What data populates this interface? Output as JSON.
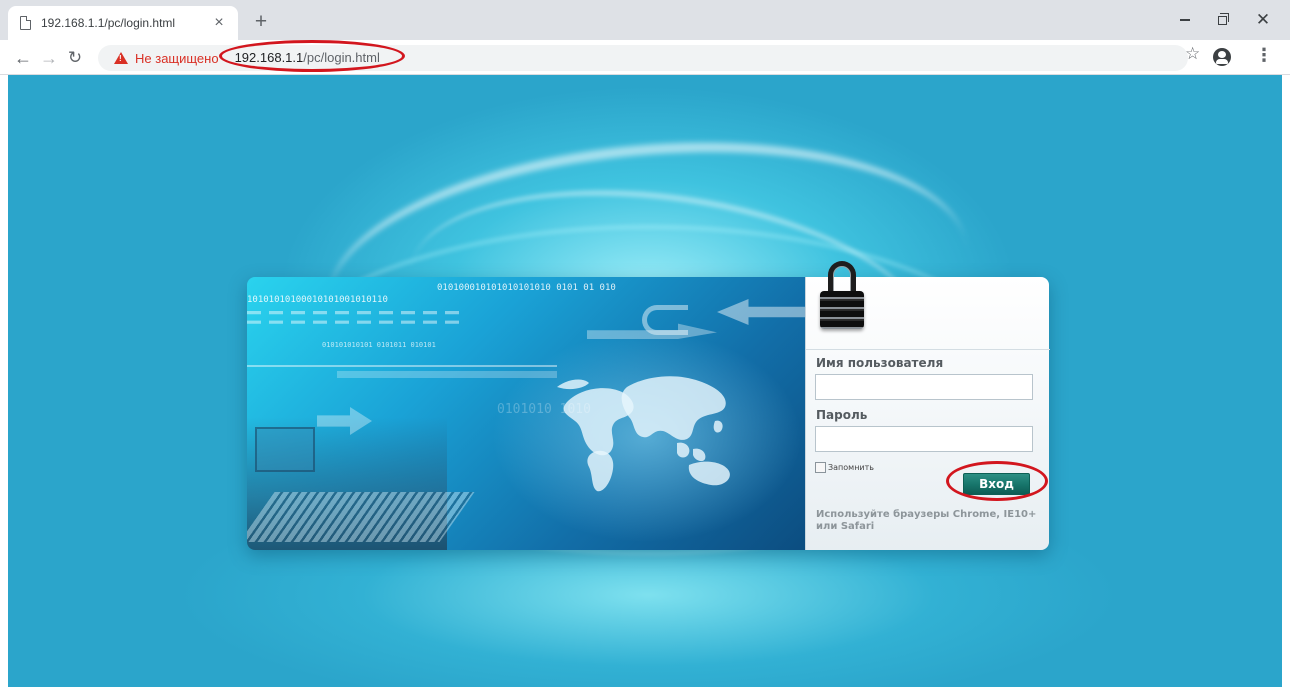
{
  "browser": {
    "tab_title": "192.168.1.1/pc/login.html",
    "tab_close": "×",
    "new_tab": "+",
    "security_label": "Не защищено",
    "url_host": "192.168.1.1",
    "url_path": "/pc/login.html"
  },
  "banner": {
    "binary_top": "010100010101010101010   0101  01 010",
    "binary_left": "10101010100010101001010110",
    "binary_small": "010101010101 0101011 010101",
    "binary_faint": "0101010  1010"
  },
  "login": {
    "username_label": "Имя пользователя",
    "username_value": "",
    "password_label": "Пароль",
    "password_value": "",
    "remember_label": "Запомнить",
    "submit_label": "Вход",
    "hint": "Используйте браузеры Chrome, IE10+ или Safari"
  },
  "colors": {
    "page_background": "#2ba5cb",
    "login_button": "#16746a",
    "not_secure": "#d93025",
    "annotation_ring": "#d2161e"
  }
}
